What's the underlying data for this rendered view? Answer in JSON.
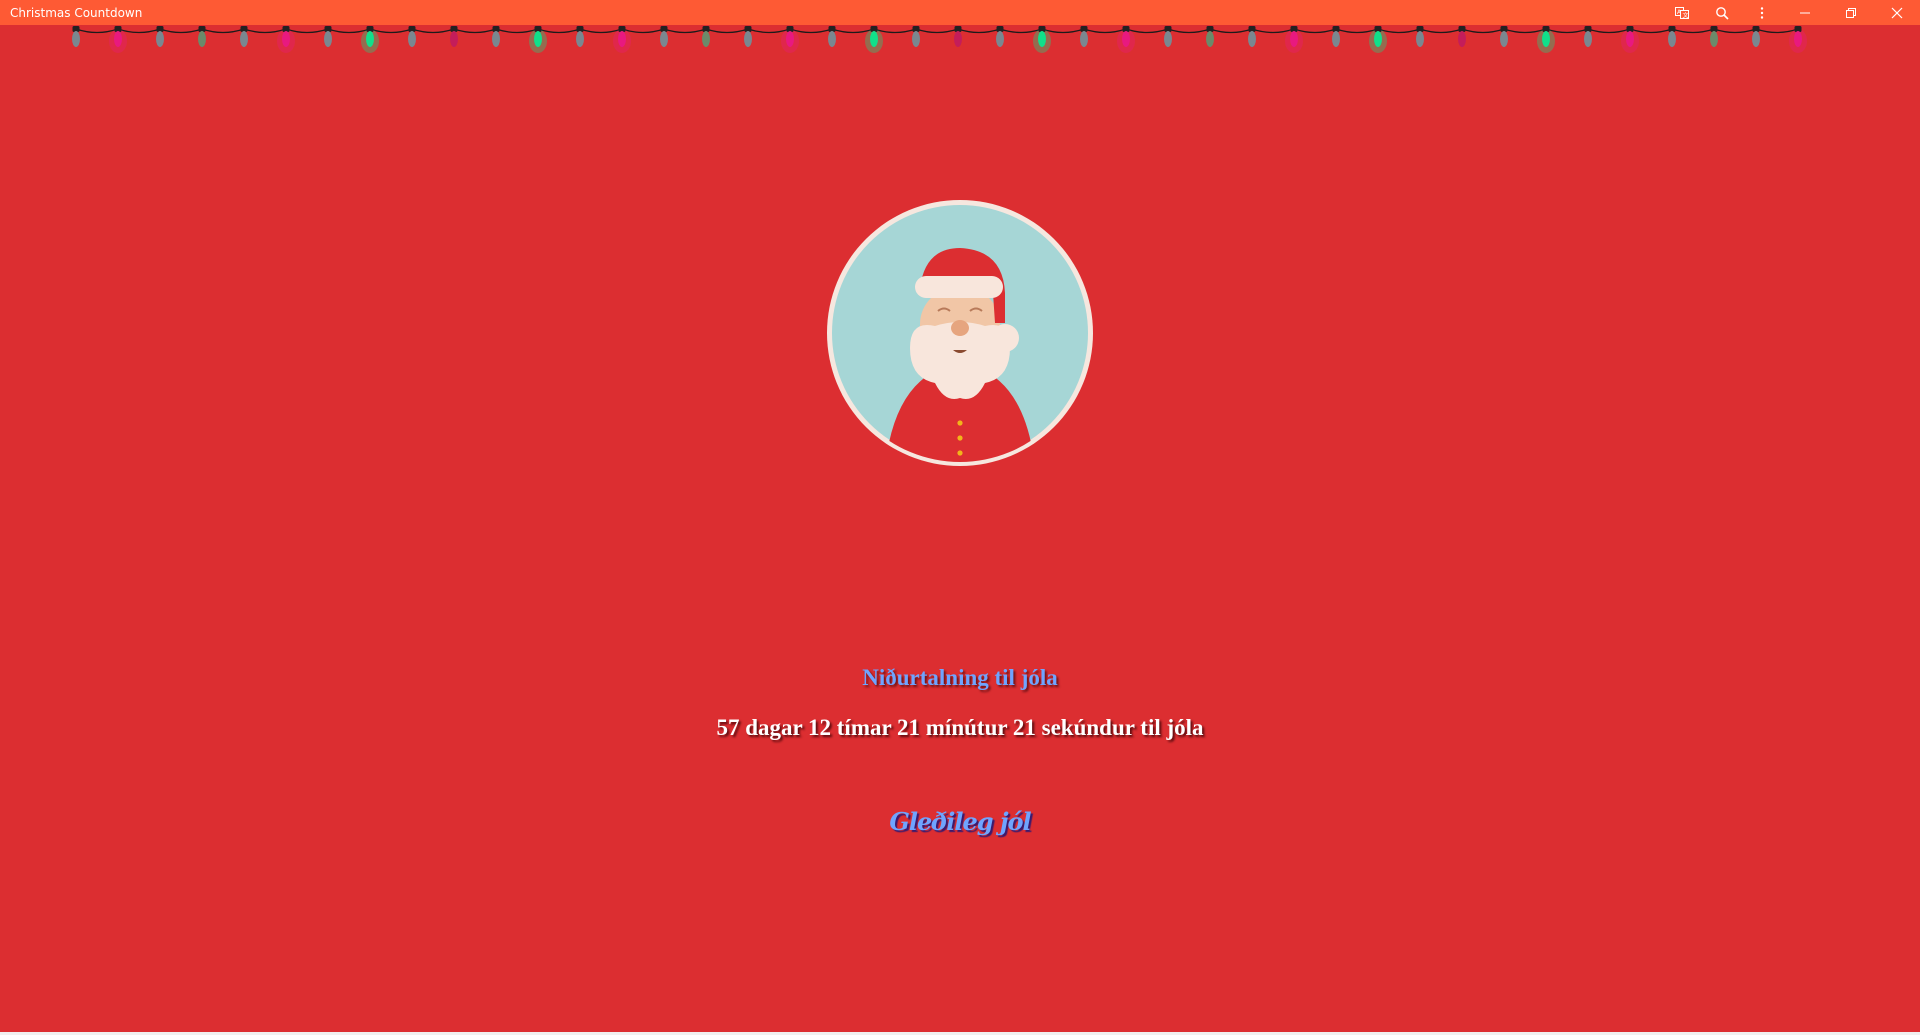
{
  "window": {
    "title": "Christmas Countdown",
    "icons": [
      "translate-icon",
      "zoom-icon",
      "more-icon",
      "minimize-icon",
      "restore-icon",
      "close-icon"
    ]
  },
  "colors": {
    "titlebar": "#fe5a34",
    "background": "#dc2e31",
    "heading": "#6fa4ff",
    "bulb_gray": "#7a8790",
    "bulb_pink": "#e8197f",
    "bulb_green": "#10e08a",
    "bulb_olive": "#6b8a6a",
    "avatar_bg": "#a6d6d6",
    "avatar_ring": "#f6e7df"
  },
  "lights": {
    "bulbs": [
      "gray",
      "pink",
      "gray",
      "olive",
      "gray",
      "pink",
      "gray",
      "green",
      "gray",
      "dim-pink",
      "gray",
      "green",
      "gray",
      "pink",
      "gray",
      "olive",
      "gray",
      "pink",
      "gray",
      "green",
      "gray",
      "dim-pink",
      "gray",
      "green",
      "gray",
      "pink",
      "gray",
      "olive",
      "gray",
      "pink",
      "gray",
      "green",
      "gray",
      "dim-pink",
      "gray",
      "green",
      "gray",
      "pink",
      "gray",
      "olive",
      "gray",
      "pink"
    ]
  },
  "main": {
    "heading": "Niðurtalning til jóla",
    "countdown": "57 dagar 12 tímar 21 mínútur 21 sekúndur til jóla",
    "greeting": "Gleðileg jól"
  }
}
